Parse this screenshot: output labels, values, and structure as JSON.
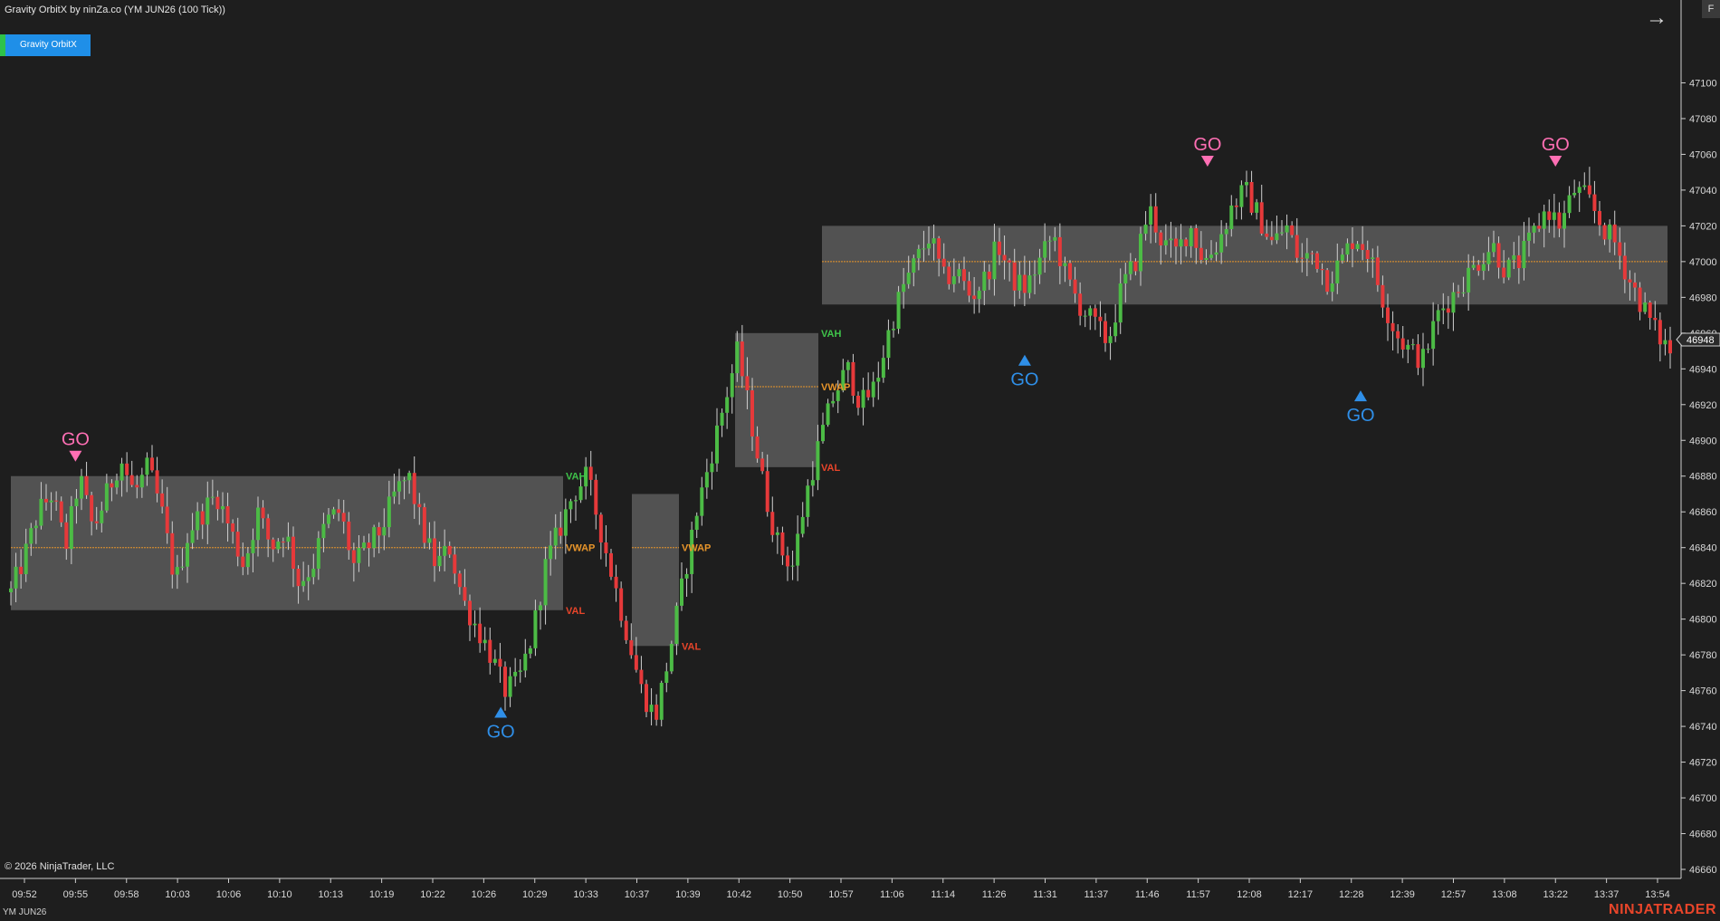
{
  "header": {
    "title": "Gravity OrbitX by ninZa.co (YM JUN26 (100 Tick))",
    "indicator_tab": "Gravity OrbitX",
    "panel_toggle": "F"
  },
  "footer": {
    "copyright": "© 2026 NinjaTrader, LLC",
    "instrument": "YM JUN26",
    "brand": "NINJATRADER"
  },
  "colors": {
    "background": "#1e1e1e",
    "up_candle": "#4cbb45",
    "down_candle": "#e6393a",
    "value_area": "#5c5c5c",
    "vwap": "#e8952a",
    "val": "#e8452a",
    "vah": "#3fc44a",
    "go_sell": "#ff6fb4",
    "go_buy": "#2f8fe8"
  },
  "chart_data": {
    "type": "candlestick",
    "ylim": [
      46660,
      47120
    ],
    "y_ticks": [
      47100,
      47080,
      47060,
      47040,
      47020,
      47000,
      46980,
      46960,
      46940,
      46920,
      46900,
      46880,
      46860,
      46840,
      46820,
      46800,
      46780,
      46760,
      46740,
      46720,
      46700,
      46680,
      46660
    ],
    "x_ticks": [
      "09:52",
      "09:55",
      "09:58",
      "10:03",
      "10:06",
      "10:10",
      "10:13",
      "10:19",
      "10:22",
      "10:26",
      "10:29",
      "10:33",
      "10:37",
      "10:39",
      "10:42",
      "10:50",
      "10:57",
      "11:06",
      "11:14",
      "11:26",
      "11:31",
      "11:37",
      "11:46",
      "11:57",
      "12:08",
      "12:17",
      "12:28",
      "12:39",
      "12:57",
      "13:08",
      "13:22",
      "13:37",
      "13:54"
    ],
    "last_price": "46948",
    "price_path": [
      46815,
      46835,
      46860,
      46870,
      46840,
      46880,
      46850,
      46870,
      46890,
      46870,
      46885,
      46860,
      46820,
      46850,
      46860,
      46870,
      46850,
      46830,
      46860,
      46840,
      46850,
      46820,
      46830,
      46855,
      46860,
      46830,
      46840,
      46850,
      46870,
      46880,
      46850,
      46830,
      46840,
      46810,
      46795,
      46780,
      46760,
      46765,
      46790,
      46830,
      46850,
      46870,
      46880,
      46850,
      46820,
      46790,
      46760,
      46745,
      46780,
      46820,
      46860,
      46890,
      46920,
      46950,
      46910,
      46870,
      46840,
      46830,
      46870,
      46900,
      46925,
      46940,
      46920,
      46930,
      46960,
      46985,
      47000,
      47015,
      46990,
      46995,
      46980,
      46990,
      47010,
      46990,
      46985,
      47000,
      47015,
      46990,
      46975,
      46965,
      46955,
      46985,
      47000,
      47030,
      47010,
      47005,
      47020,
      47000,
      47010,
      47030,
      47040,
      47025,
      47010,
      47020,
      47000,
      47005,
      46990,
      47000,
      47015,
      47005,
      46980,
      46960,
      46950,
      46945,
      46970,
      46980,
      46990,
      47000,
      47010,
      46995,
      47000,
      47015,
      47030,
      47020,
      47040,
      47035,
      47020,
      47010,
      46990,
      46975,
      46960,
      46950
    ],
    "segments": [
      {
        "vah": 46880,
        "val": 46805,
        "vwap": 46840,
        "vah_label": "VAH",
        "val_label": "VAL",
        "vwap_label": "VWAP"
      },
      {
        "vah": 46870,
        "val": 46785,
        "vwap": 46840,
        "vah_label": "",
        "val_label": "VAL",
        "vwap_label": "VWAP"
      },
      {
        "vah": 46960,
        "val": 46885,
        "vwap": 46930,
        "vah_label": "VAH",
        "val_label": "VAL",
        "vwap_label": "VWAP"
      },
      {
        "vah": 47020,
        "val": 46976,
        "vwap": 47000,
        "vah_label": "",
        "val_label": "",
        "vwap_label": ""
      }
    ],
    "signals": [
      {
        "label": "GO",
        "direction": "sell",
        "time": "09:55",
        "price": 46880
      },
      {
        "label": "GO",
        "direction": "buy",
        "time": "10:27",
        "price": 46758
      },
      {
        "label": "GO",
        "direction": "buy",
        "time": "11:29",
        "price": 46955
      },
      {
        "label": "GO",
        "direction": "sell",
        "time": "11:59",
        "price": 47045
      },
      {
        "label": "GO",
        "direction": "buy",
        "time": "12:30",
        "price": 46935
      },
      {
        "label": "GO",
        "direction": "sell",
        "time": "13:22",
        "price": 47045
      }
    ]
  }
}
